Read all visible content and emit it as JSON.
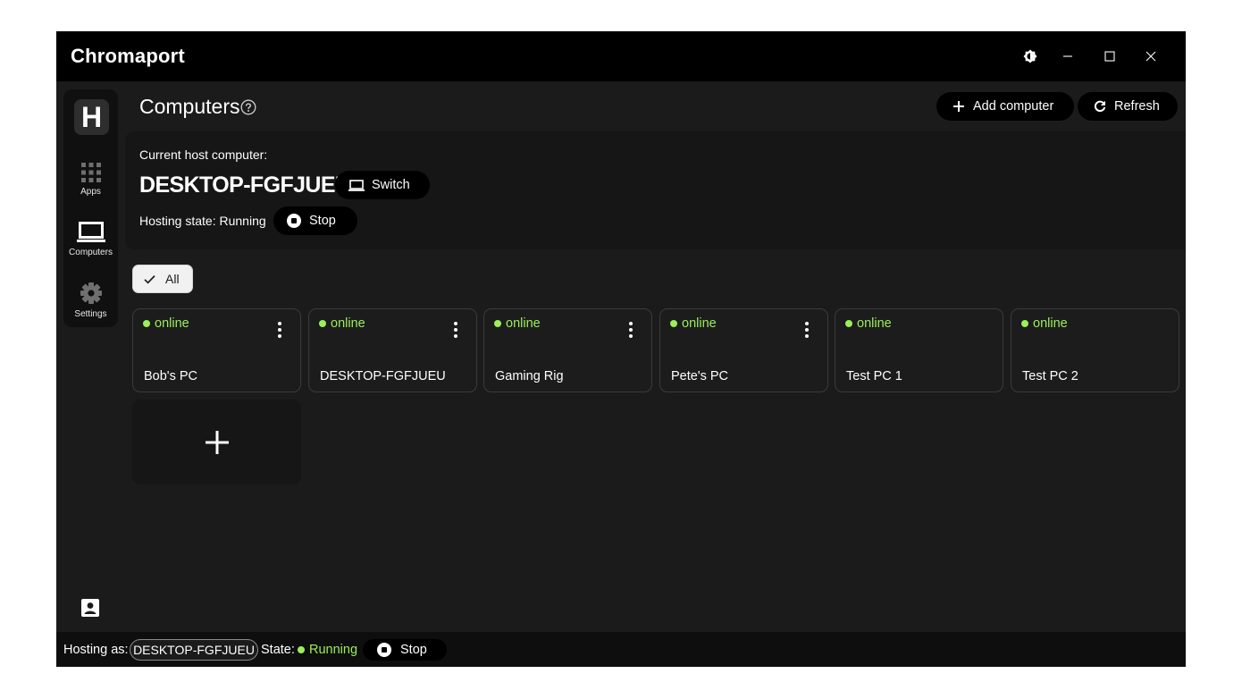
{
  "app": {
    "title": "Chromaport"
  },
  "titlebar": {
    "icons": [
      "brightness-icon",
      "minimize-icon",
      "maximize-icon",
      "close-icon"
    ]
  },
  "sidebar": {
    "avatar_letter": "H",
    "items": [
      {
        "label": "Apps",
        "icon": "grid-icon"
      },
      {
        "label": "Computers",
        "icon": "laptop-icon"
      },
      {
        "label": "Settings",
        "icon": "gear-icon"
      }
    ],
    "profile_icon": "contact-card-icon"
  },
  "header": {
    "title": "Computers",
    "add_label": "Add computer",
    "refresh_label": "Refresh"
  },
  "host": {
    "label": "Current host computer:",
    "name": "DESKTOP-FGFJUEU",
    "switch_label": "Switch",
    "state_text": "Hosting state: Running",
    "stop_label": "Stop"
  },
  "filter": {
    "label": "All"
  },
  "computers": [
    {
      "status": "online",
      "name": "Bob's PC",
      "has_menu": true
    },
    {
      "status": "online",
      "name": "DESKTOP-FGFJUEU",
      "has_menu": true
    },
    {
      "status": "online",
      "name": "Gaming Rig",
      "has_menu": true
    },
    {
      "status": "online",
      "name": "Pete's PC",
      "has_menu": true
    },
    {
      "status": "online",
      "name": "Test PC 1",
      "has_menu": false
    },
    {
      "status": "online",
      "name": "Test PC 2",
      "has_menu": false
    }
  ],
  "add_card": {
    "symbol": "+"
  },
  "statusbar": {
    "hosting_label": "Hosting as:",
    "hosting_name": "DESKTOP-FGFJUEU",
    "state_label": "State:",
    "state_value": "Running",
    "stop_label": "Stop"
  },
  "colors": {
    "online": "#9cef58",
    "background": "#1b1b1b",
    "titlebar": "#000000"
  }
}
